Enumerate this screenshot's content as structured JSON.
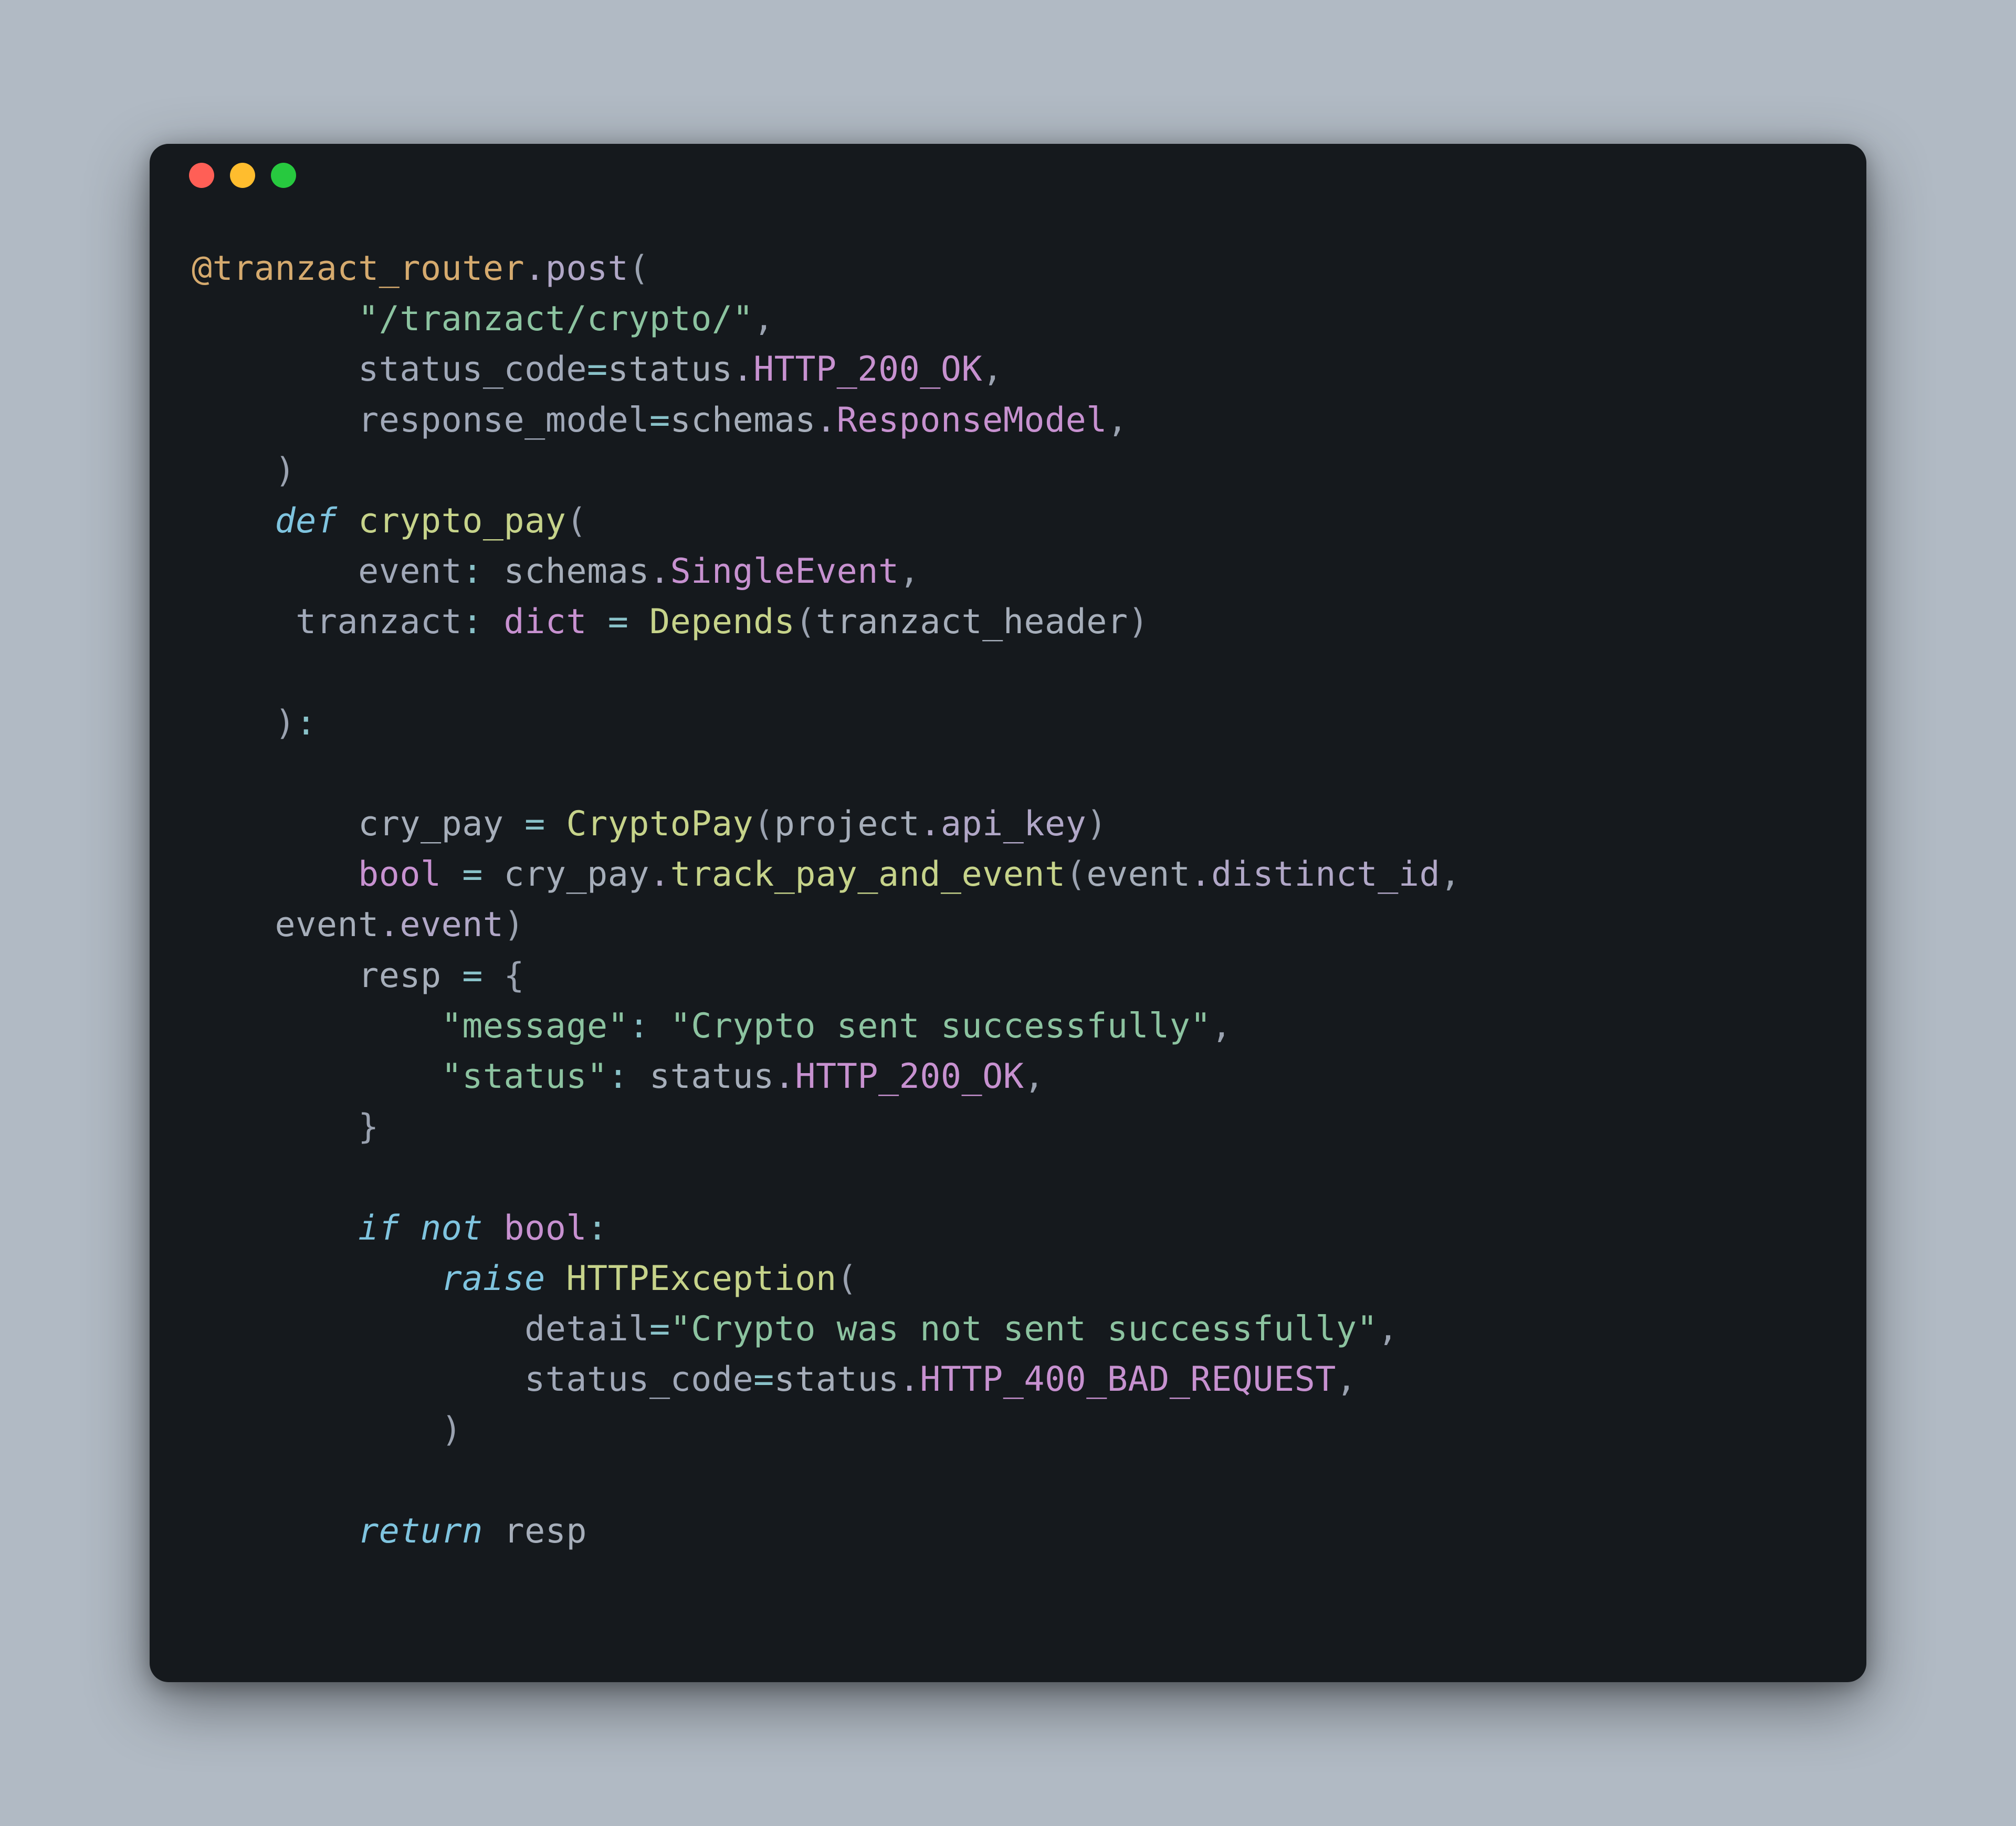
{
  "colors": {
    "background": "#b1bac4",
    "window": "#15191d",
    "trafficRed": "#ff5f56",
    "trafficYellow": "#ffbd2e",
    "trafficGreen": "#27c93f"
  },
  "code": {
    "t1": "@tranzact_router",
    "t2": ".",
    "t3": "post",
    "t4": "(",
    "t5": "        ",
    "t6": "\"/tranzact/crypto/\"",
    "t7": ",",
    "t8": "        ",
    "t9": "status_code",
    "t10": "=",
    "t11": "status",
    "t12": ".",
    "t13": "HTTP_200_OK",
    "t14": ",",
    "t15": "        ",
    "t16": "response_model",
    "t17": "=",
    "t18": "schemas",
    "t19": ".",
    "t20": "ResponseModel",
    "t21": ",",
    "t22": "    ",
    "t23": ")",
    "t24": "    ",
    "t25": "def",
    "t26": " ",
    "t27": "crypto_pay",
    "t28": "(",
    "t29": "        ",
    "t30": "event",
    "t31": ": ",
    "t32": "schemas",
    "t33": ".",
    "t34": "SingleEvent",
    "t35": ",",
    "t36": "     ",
    "t37": "tranzact",
    "t38": ": ",
    "t39": "dict",
    "t40": " ",
    "t41": "=",
    "t42": " ",
    "t43": "Depends",
    "t44": "(",
    "t45": "tranzact_header",
    "t46": ")",
    "t47": "    ",
    "t48": ")",
    "t49": ":",
    "t50": "        ",
    "t51": "cry_pay",
    "t52": " ",
    "t53": "=",
    "t54": " ",
    "t55": "CryptoPay",
    "t56": "(",
    "t57": "project",
    "t58": ".",
    "t59": "api_key",
    "t60": ")",
    "t61": "        ",
    "t62": "bool",
    "t63": " ",
    "t64": "=",
    "t65": " ",
    "t66": "cry_pay",
    "t67": ".",
    "t68": "track_pay_and_event",
    "t69": "(",
    "t70": "event",
    "t71": ".",
    "t72": "distinct_id",
    "t73": ", ",
    "t74": "    ",
    "t75": "event",
    "t76": ".",
    "t77": "event",
    "t78": ")",
    "t79": "        ",
    "t80": "resp",
    "t81": " ",
    "t82": "=",
    "t83": " ",
    "t84": "{",
    "t85": "            ",
    "t86": "\"message\"",
    "t87": ": ",
    "t88": "\"Crypto sent successfully\"",
    "t89": ",",
    "t90": "            ",
    "t91": "\"status\"",
    "t92": ": ",
    "t93": "status",
    "t94": ".",
    "t95": "HTTP_200_OK",
    "t96": ",",
    "t97": "        ",
    "t98": "}",
    "t99": "        ",
    "t100": "if",
    "t101": " ",
    "t102": "not",
    "t103": " ",
    "t104": "bool",
    "t105": ":",
    "t106": "            ",
    "t107": "raise",
    "t108": " ",
    "t109": "HTTPException",
    "t110": "(",
    "t111": "                ",
    "t112": "detail",
    "t113": "=",
    "t114": "\"Crypto was not sent successfully\"",
    "t115": ",",
    "t116": "                ",
    "t117": "status_code",
    "t118": "=",
    "t119": "status",
    "t120": ".",
    "t121": "HTTP_400_BAD_REQUEST",
    "t122": ",",
    "t123": "            ",
    "t124": ")",
    "t125": "        ",
    "t126": "return",
    "t127": " ",
    "t128": "resp"
  }
}
